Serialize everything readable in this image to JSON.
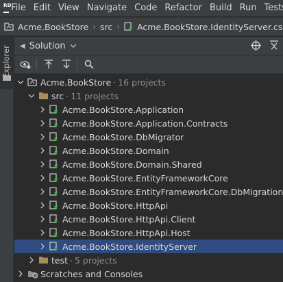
{
  "menubar": {
    "logo_text": "RD",
    "items": [
      "File",
      "Edit",
      "View",
      "Navigate",
      "Code",
      "Refactor",
      "Build",
      "Run",
      "Tests"
    ]
  },
  "breadcrumb": {
    "solution": "Acme.BookStore",
    "folder": "src",
    "project": "Acme.BookStore.IdentityServer.csproj"
  },
  "stripe": {
    "label": "Explorer"
  },
  "tool_window": {
    "title": "Solution"
  },
  "tree": {
    "solution": {
      "name": "Acme.BookStore",
      "hint": "16 projects"
    },
    "src": {
      "name": "src",
      "hint": "11 projects"
    },
    "projects": [
      "Acme.BookStore.Application",
      "Acme.BookStore.Application.Contracts",
      "Acme.BookStore.DbMigrator",
      "Acme.BookStore.Domain",
      "Acme.BookStore.Domain.Shared",
      "Acme.BookStore.EntityFrameworkCore",
      "Acme.BookStore.EntityFrameworkCore.DbMigrations",
      "Acme.BookStore.HttpApi",
      "Acme.BookStore.HttpApi.Client",
      "Acme.BookStore.HttpApi.Host",
      "Acme.BookStore.IdentityServer"
    ],
    "selected_project": "Acme.BookStore.IdentityServer",
    "test": {
      "name": "test",
      "hint": "5 projects"
    },
    "scratches": "Scratches and Consoles"
  },
  "colors": {
    "background": "#2b2b2b",
    "panel": "#3c3f41",
    "selection": "#2f4b80",
    "project_icon_green": "#3fae3f",
    "folder_tan": "#a88d5d"
  }
}
